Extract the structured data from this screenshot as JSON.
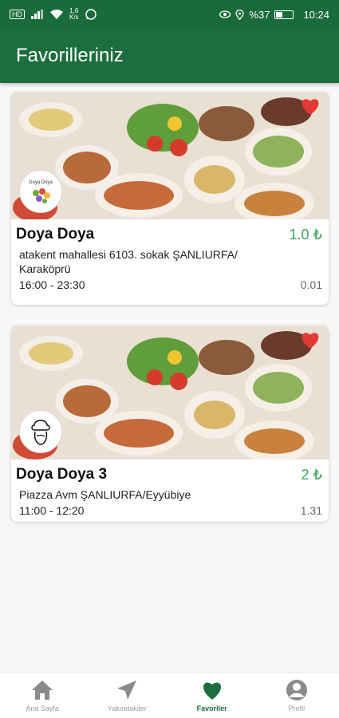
{
  "status_bar": {
    "left_chip": "HD",
    "speed_value": "1,6",
    "speed_unit": "K/s",
    "battery_percent": "%37",
    "time": "10:24"
  },
  "app_bar": {
    "title": "Favorilleriniz"
  },
  "favorites": [
    {
      "name": "Doya Doya",
      "price": "1.0 ₺",
      "address": "atakent mahallesi 6103. sokak ŞANLIURFA/ Karaköprü",
      "hours": "16:00 - 23:30",
      "distance": "0.01",
      "logo_text": "Doya Doya",
      "favorite_icon": "heart-icon"
    },
    {
      "name": "Doya Doya 3",
      "price": "2 ₺",
      "address": "Piazza Avm ŞANLIURFA/Eyyübiye",
      "hours": "11:00 - 12:20",
      "distance": "1.31",
      "favorite_icon": "heart-icon"
    }
  ],
  "bottom_nav": {
    "items": [
      {
        "label": "Ana Sayfa",
        "icon": "home-icon"
      },
      {
        "label": "Yakındakiler",
        "icon": "navigation-arrow-icon"
      },
      {
        "label": "Favoriler",
        "icon": "heart-icon",
        "active": true
      },
      {
        "label": "Profil",
        "icon": "profile-icon"
      }
    ]
  },
  "colors": {
    "primary": "#1d6e3f",
    "price": "#3aa65a",
    "heart": "#e53935"
  }
}
